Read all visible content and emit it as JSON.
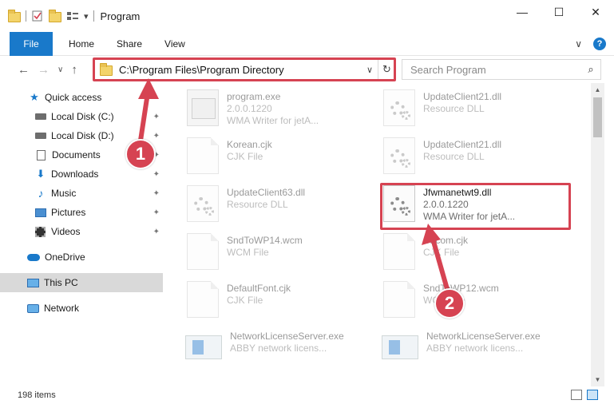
{
  "window": {
    "title": "Program",
    "minimize_glyph": "—",
    "maximize_glyph": "☐",
    "close_glyph": "✕"
  },
  "quick_access_toolbar": {
    "dropdown_glyph": "▾"
  },
  "ribbon": {
    "file_tab": "File",
    "tabs": [
      "Home",
      "Share",
      "View"
    ],
    "expand_glyph": "∨",
    "help_glyph": "?"
  },
  "address_bar": {
    "path": "C:\\Program Files\\Program Directory",
    "dropdown_glyph": "∨",
    "refresh_glyph": "↻"
  },
  "navigation": {
    "back_glyph": "←",
    "forward_glyph": "→",
    "recent_glyph": "∨",
    "up_glyph": "↑"
  },
  "search": {
    "placeholder": "Search Program",
    "icon": "search-icon",
    "icon_glyph": "⌕"
  },
  "nav_pane": {
    "items": [
      {
        "label": "Quick access",
        "icon": "star-icon",
        "pinned": false
      },
      {
        "label": "Local Disk (C:)",
        "icon": "drive-icon",
        "pinned": true
      },
      {
        "label": "Local Disk (D:)",
        "icon": "drive-icon",
        "pinned": true
      },
      {
        "label": "Documents",
        "icon": "documents-icon",
        "pinned": true
      },
      {
        "label": "Downloads",
        "icon": "download-icon",
        "pinned": true
      },
      {
        "label": "Music",
        "icon": "music-icon",
        "pinned": true
      },
      {
        "label": "Pictures",
        "icon": "pictures-icon",
        "pinned": true
      },
      {
        "label": "Videos",
        "icon": "videos-icon",
        "pinned": true
      },
      {
        "label": "OneDrive",
        "icon": "cloud-icon",
        "pinned": false
      },
      {
        "label": "This PC",
        "icon": "computer-icon",
        "pinned": false,
        "selected": true
      },
      {
        "label": "Network",
        "icon": "network-icon",
        "pinned": false
      }
    ],
    "pin_glyph": "📌"
  },
  "files": [
    {
      "name": "program.exe",
      "line2": "2.0.0.1220",
      "line3": "WMA Writer for jetA...",
      "icon": "exe-icon"
    },
    {
      "name": "UpdateClient21.dll",
      "line2": "Resource DLL",
      "line3": "",
      "icon": "dll-icon"
    },
    {
      "name": "Korean.cjk",
      "line2": "CJK File",
      "line3": "",
      "icon": "file-icon"
    },
    {
      "name": "UpdateClient21.dll",
      "line2": "Resource DLL",
      "line3": "",
      "icon": "dll-icon"
    },
    {
      "name": "UpdateClient63.dll",
      "line2": "Resource DLL",
      "line3": "",
      "icon": "dll-icon"
    },
    {
      "name": "Jfwmanetwt9.dll",
      "line2": "2.0.0.1220",
      "line3": "WMA Writer for jetA...",
      "icon": "dll-icon",
      "highlighted": true
    },
    {
      "name": "SndToWP14.wcm",
      "line2": "WCM File",
      "line3": "",
      "icon": "file-icon"
    },
    {
      "name": "Chcom.cjk",
      "line2": "CJK File",
      "line3": "",
      "icon": "file-icon"
    },
    {
      "name": "DefaultFont.cjk",
      "line2": "CJK File",
      "line3": "",
      "icon": "file-icon"
    },
    {
      "name": "SndToWP12.wcm",
      "line2": "WCM File",
      "line3": "",
      "icon": "file-icon"
    },
    {
      "name": "NetworkLicenseServer.exe",
      "line2": "ABBY network licens...",
      "line3": "",
      "icon": "network-exe-icon"
    },
    {
      "name": "NetworkLicenseServer.exe",
      "line2": "ABBY network licens...",
      "line3": "",
      "icon": "network-exe-icon"
    }
  ],
  "scrollbar": {
    "up_glyph": "▲",
    "down_glyph": "▼"
  },
  "status_bar": {
    "item_count": "198 items"
  },
  "annotations": [
    {
      "number": "1"
    },
    {
      "number": "2"
    }
  ],
  "colors": {
    "accent": "#1979ca",
    "highlight": "#d64352"
  }
}
